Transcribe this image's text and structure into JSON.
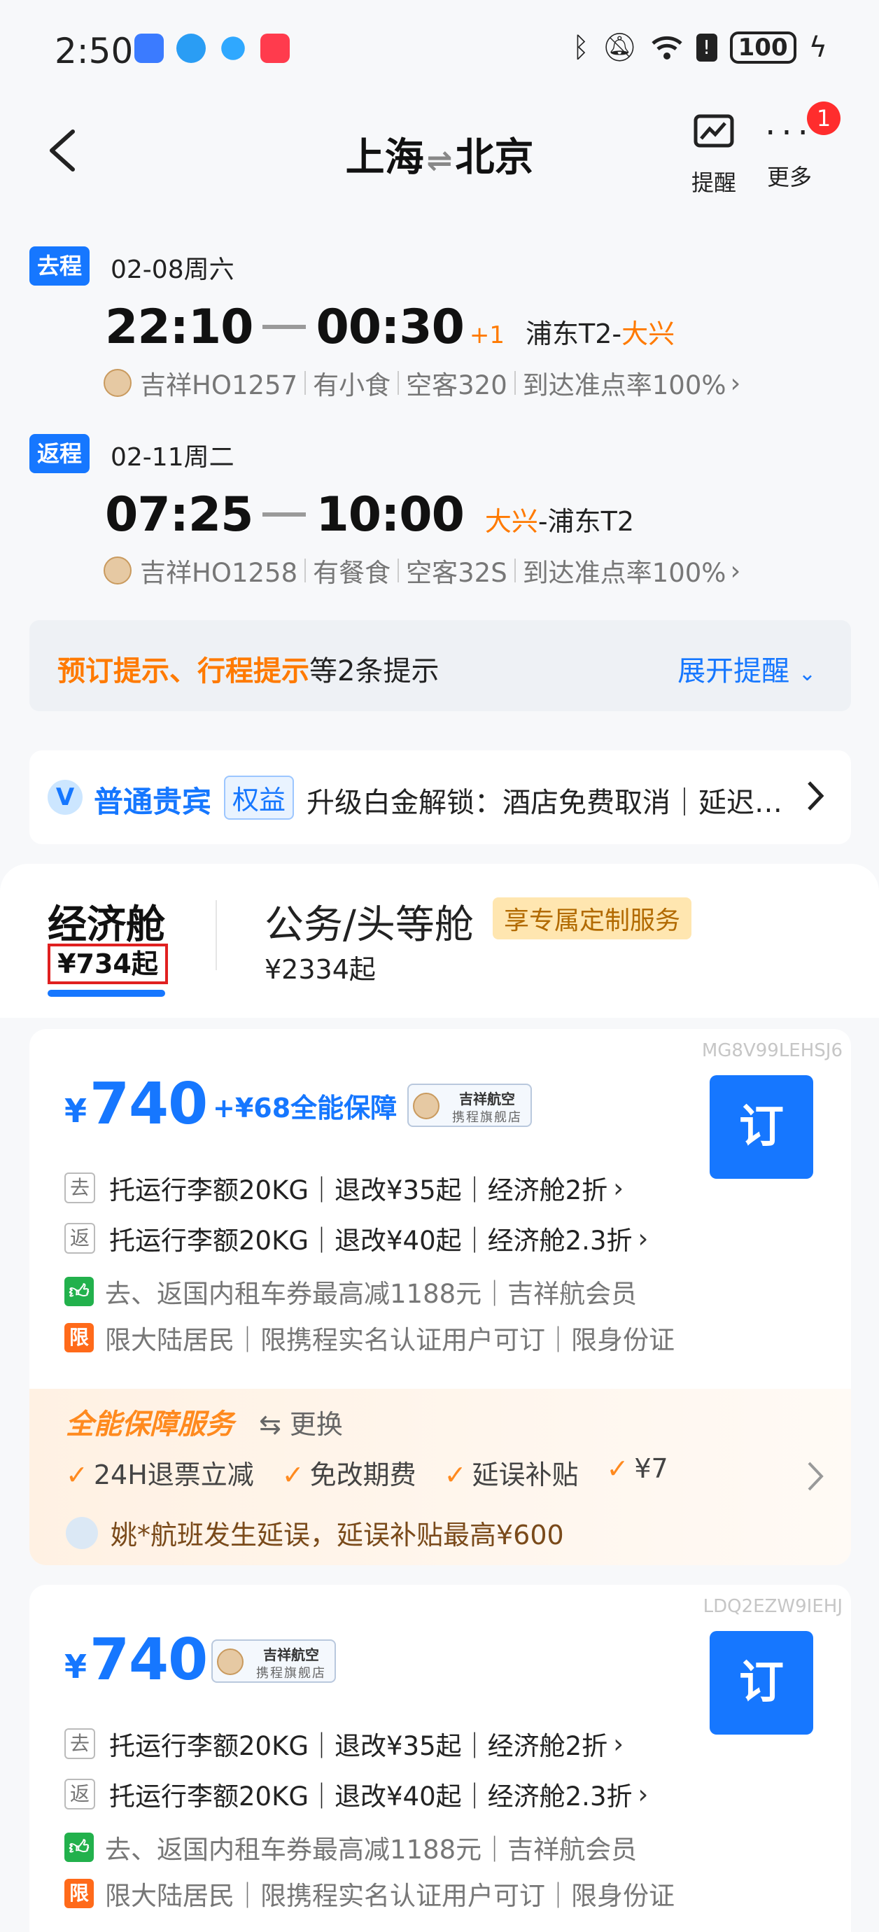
{
  "status_bar": {
    "time": "2:50",
    "battery": "100",
    "icons": [
      "bluetooth-icon",
      "mute-icon",
      "wifi-icon",
      "alert-icon",
      "charging-icon"
    ],
    "app_icons": [
      "usb-icon",
      "browser-icon",
      "app-icon",
      "game-app-icon"
    ]
  },
  "header": {
    "from": "上海",
    "to": "北京",
    "swap_symbol": "⇌",
    "alert_label": "提醒",
    "more_label": "更多",
    "more_badge": "1"
  },
  "trips": [
    {
      "tag": "去程",
      "date": "02-08周六",
      "depart": "22:10",
      "arrive": "00:30",
      "plus_day": "+1",
      "airport_from": "浦东T2",
      "airport_to": "大兴",
      "highlight": "to",
      "airline": "吉祥HO1257",
      "meal": "有小食",
      "aircraft": "空客320",
      "punctuality": "到达准点率100%"
    },
    {
      "tag": "返程",
      "date": "02-11周二",
      "depart": "07:25",
      "arrive": "10:00",
      "plus_day": "",
      "airport_from": "大兴",
      "airport_to": "浦东T2",
      "highlight": "from",
      "airline": "吉祥HO1258",
      "meal": "有餐食",
      "aircraft": "空客32S",
      "punctuality": "到达准点率100%"
    }
  ],
  "notice": {
    "highlight": "预订提示、行程提示",
    "rest": "等2条提示",
    "expand": "展开提醒"
  },
  "member": {
    "name": "普通贵宾",
    "tag": "权益",
    "text": "升级白金解锁：酒店免费取消｜延迟…"
  },
  "cabins": {
    "economy_label": "经济舱",
    "economy_price": "¥734起",
    "business_label": "公务/头等舱",
    "business_badge": "享专属定制服务",
    "business_price": "¥2334起"
  },
  "offers": [
    {
      "code": "MG8V99LEHSJ6",
      "currency": "¥",
      "price": "740",
      "addon": "+¥68全能保障",
      "store_name": "吉祥航空",
      "store_sub": "携程旗舰店",
      "book_label": "订",
      "rules": [
        {
          "tag": "去",
          "text": "托运行李额20KG｜退改¥35起｜经济舱2折"
        },
        {
          "tag": "返",
          "text": "托运行李额20KG｜退改¥40起｜经济舱2.3折"
        }
      ],
      "perk1": "去、返国内租车券最高减1188元｜吉祥航会员",
      "perk2_icon": "限",
      "perk2": "限大陆居民｜限携程实名认证用户可订｜限身份证",
      "service": {
        "title": "全能保障服务",
        "swap": "⇆ 更换",
        "items": [
          "24H退票立减",
          "免改期费",
          "延误补贴",
          "¥7"
        ],
        "user_text": "姚*航班发生延误，延误补贴最高¥600"
      }
    },
    {
      "code": "LDQ2EZW9IEHJ",
      "currency": "¥",
      "price": "740",
      "store_name": "吉祥航空",
      "store_sub": "携程旗舰店",
      "book_label": "订",
      "rules": [
        {
          "tag": "去",
          "text": "托运行李额20KG｜退改¥35起｜经济舱2折"
        },
        {
          "tag": "返",
          "text": "托运行李额20KG｜退改¥40起｜经济舱2.3折"
        }
      ],
      "perk1": "去、返国内租车券最高减1188元｜吉祥航会员",
      "perk2_icon": "限",
      "perk2": "限大陆居民｜限携程实名认证用户可订｜限身份证"
    }
  ],
  "colors": {
    "brand_blue": "#1677ff",
    "accent_orange": "#ff7a00",
    "badge_red": "#ff2d2d"
  }
}
